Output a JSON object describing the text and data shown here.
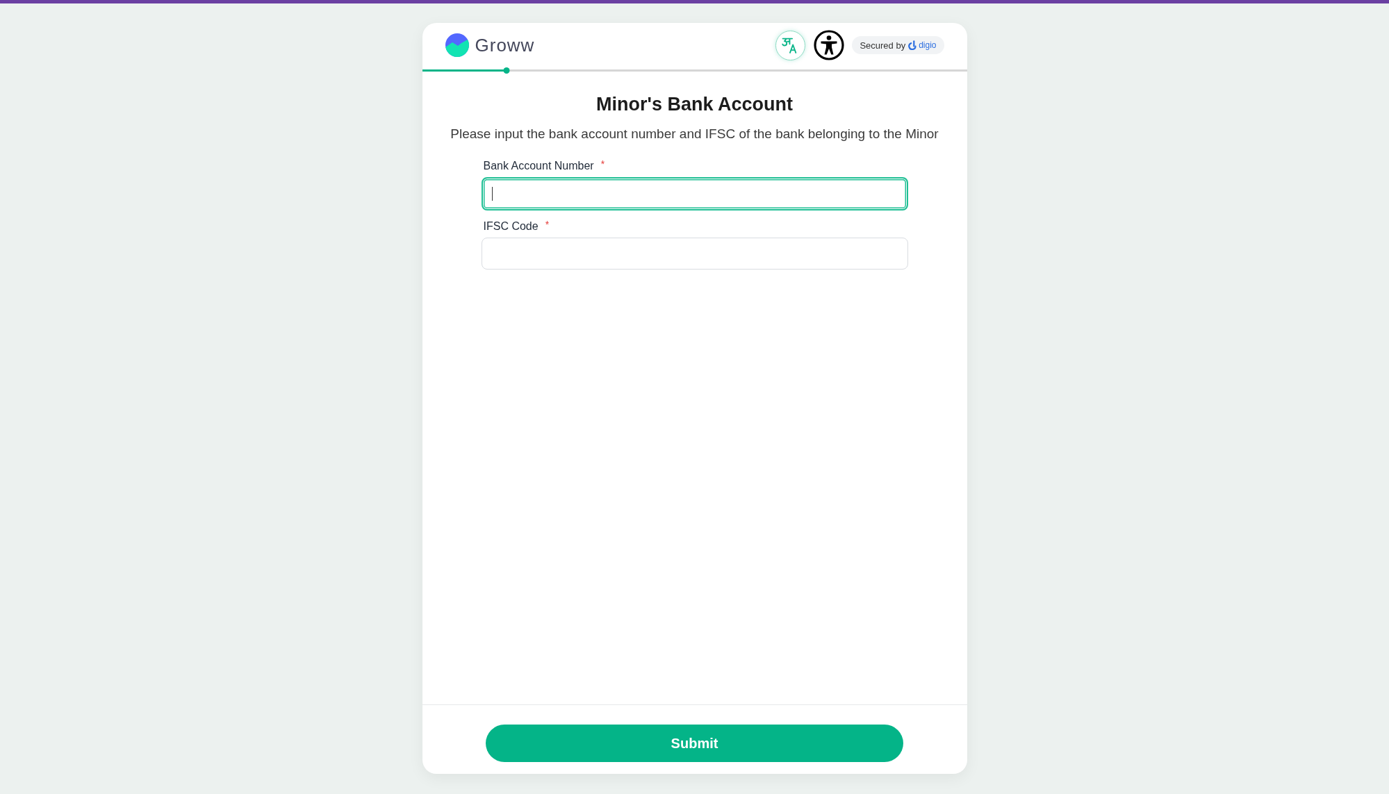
{
  "header": {
    "logo_text": "Groww",
    "progress": {
      "level": 0.155
    },
    "secured_badge": {
      "prefix": "Secured by",
      "brand": "digio"
    }
  },
  "title": "Minor's Bank Account",
  "description": "Please input the bank account number and IFSC of the bank belonging to the Minor",
  "fields": [
    {
      "label": "Bank Account Number",
      "required_mark": "*",
      "focused": true
    },
    {
      "label": "IFSC Code",
      "required_mark": "*",
      "focused": false
    }
  ],
  "submit_button": {
    "label": "Submit"
  }
}
